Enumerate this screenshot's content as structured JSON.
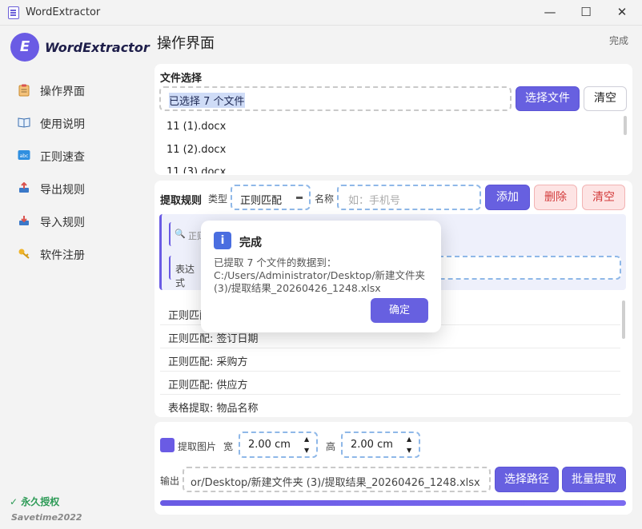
{
  "window": {
    "title": "WordExtractor",
    "minimize": "—",
    "maximize": "☐",
    "close": "✕"
  },
  "sidebar": {
    "logo_letter": "E",
    "logo_text": "WordExtractor",
    "items": [
      {
        "label": "操作界面",
        "icon": "clipboard-icon"
      },
      {
        "label": "使用说明",
        "icon": "book-icon"
      },
      {
        "label": "正则速查",
        "icon": "abc-icon"
      },
      {
        "label": "导出规则",
        "icon": "export-icon"
      },
      {
        "label": "导入规则",
        "icon": "import-icon"
      },
      {
        "label": "软件注册",
        "icon": "key-icon"
      }
    ],
    "license": "✓ 永久授权",
    "savetime": "Savetime2022"
  },
  "header": {
    "title": "操作界面",
    "status": "完成"
  },
  "file_section": {
    "label": "文件选择",
    "selected_text": "已选择 7 个文件",
    "choose_button": "选择文件",
    "clear_button": "清空",
    "files": [
      "11 (1).docx",
      "11 (2).docx",
      "11 (3).docx"
    ]
  },
  "rules_section": {
    "label": "提取规则",
    "type_label": "类型",
    "type_value": "正则匹配",
    "name_label": "名称",
    "name_placeholder": "如：手机号",
    "add_button": "添加",
    "delete_button": "删除",
    "clear_button": "清空",
    "pattern_hint": "正则",
    "expr_label": "表达式",
    "rules": [
      "正则匹配: 合同编号",
      "正则匹配: 签订日期",
      "正则匹配: 采购方",
      "正则匹配: 供应方",
      "表格提取: 物品名称"
    ]
  },
  "output_section": {
    "image_label": "提取图片",
    "width_label": "宽",
    "width_value": "2.00 cm",
    "height_label": "高",
    "height_value": "2.00 cm",
    "output_label": "输出",
    "output_path": "or/Desktop/新建文件夹 (3)/提取结果_20260426_1248.xlsx",
    "choose_path_button": "选择路径",
    "batch_button": "批量提取",
    "progress": 1.0
  },
  "dialog": {
    "title": "完成",
    "message": "已提取 7 个文件的数据到：C:/Users/Administrator/Desktop/新建文件夹 (3)/提取结果_20260426_1248.xlsx",
    "ok_button": "确定"
  },
  "colors": {
    "accent": "#6760e0",
    "danger": "#d33b3b",
    "success": "#2e9b57"
  }
}
